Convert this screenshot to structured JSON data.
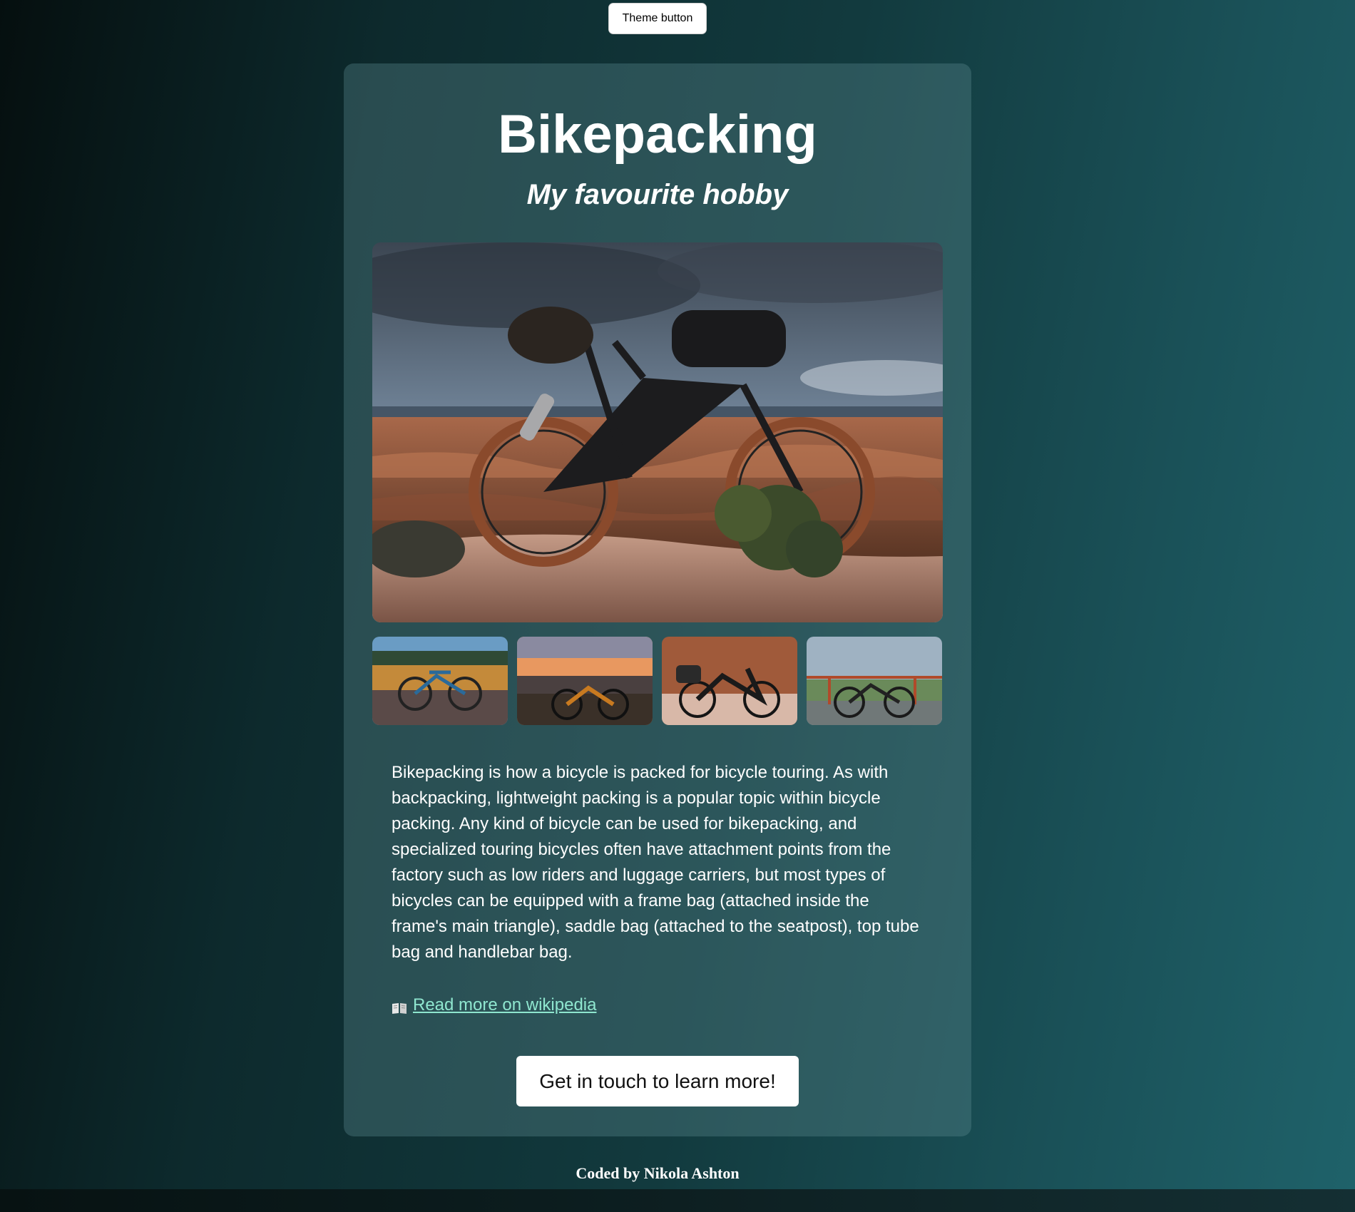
{
  "theme_button": {
    "label": "Theme button"
  },
  "card": {
    "title": "Bikepacking",
    "subtitle": "My favourite hobby",
    "hero_image": {
      "subject": "loaded bikepacking bike on a desert canyon rim"
    },
    "thumbnails": [
      {
        "subject": "bike with blue bags by a lake"
      },
      {
        "subject": "bike at sunset on a hilltop"
      },
      {
        "subject": "loaded bike against red rock"
      },
      {
        "subject": "gravel bike leaning on a railing"
      }
    ],
    "description": "Bikepacking is how a bicycle is packed for bicycle touring. As with backpacking, lightweight packing is a popular topic within bicycle packing. Any kind of bicycle can be used for bikepacking, and specialized touring bicycles often have attachment points from the factory such as low riders and luggage carriers, but most types of bicycles can be equipped with a frame bag (attached inside the frame's main triangle), saddle bag (attached to the seatpost), top tube bag and handlebar bag.",
    "wiki_icon": "open-book-icon",
    "wiki_link": "Read more on wikipedia",
    "cta_label": "Get in touch to learn more!"
  },
  "footer": {
    "credit": "Coded by Nikola Ashton"
  },
  "colors": {
    "link": "#8fe6cf",
    "card_background": "rgba(95,140,145,0.35)",
    "page_gradient_start": "#050f0f",
    "page_gradient_end": "#1f626a"
  }
}
